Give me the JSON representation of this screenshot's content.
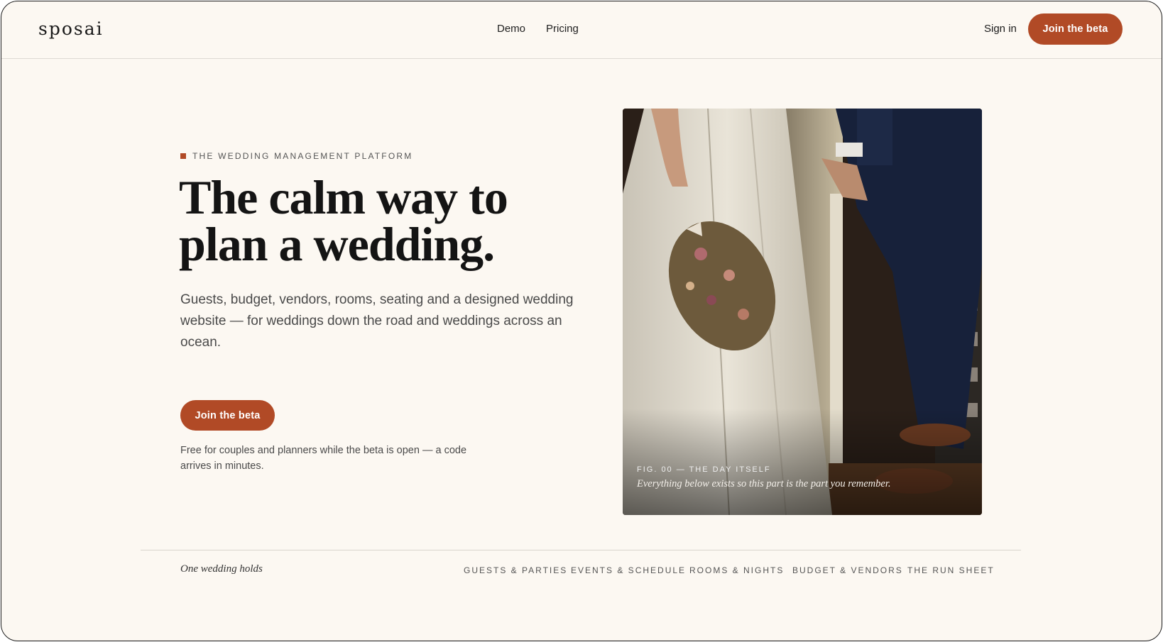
{
  "header": {
    "logo": "sposai",
    "nav": {
      "demo": "Demo",
      "pricing": "Pricing"
    },
    "sign_in": "Sign in",
    "cta": "Join the beta"
  },
  "hero": {
    "eyebrow": "THE WEDDING MANAGEMENT PLATFORM",
    "headline_line1": "The calm way to",
    "headline_line2": "plan a wedding.",
    "subhead": "Guests, budget, vendors, rooms, seating and a designed wedding website — for weddings down the road and weddings across an ocean.",
    "cta": "Join the beta",
    "note": "Free for couples and planners while the beta is open — a code arrives in minutes."
  },
  "photo": {
    "label": "FIG. 00 — THE DAY ITSELF",
    "caption": "Everything below exists so this part is the part you remember."
  },
  "strip": {
    "intro": "One wedding holds",
    "features": [
      "GUESTS & PARTIES",
      "EVENTS & SCHEDULE",
      "ROOMS & NIGHTS",
      "BUDGET & VENDORS",
      "THE RUN SHEET"
    ]
  },
  "colors": {
    "accent": "#b14a26",
    "background": "#fcf8f2"
  }
}
